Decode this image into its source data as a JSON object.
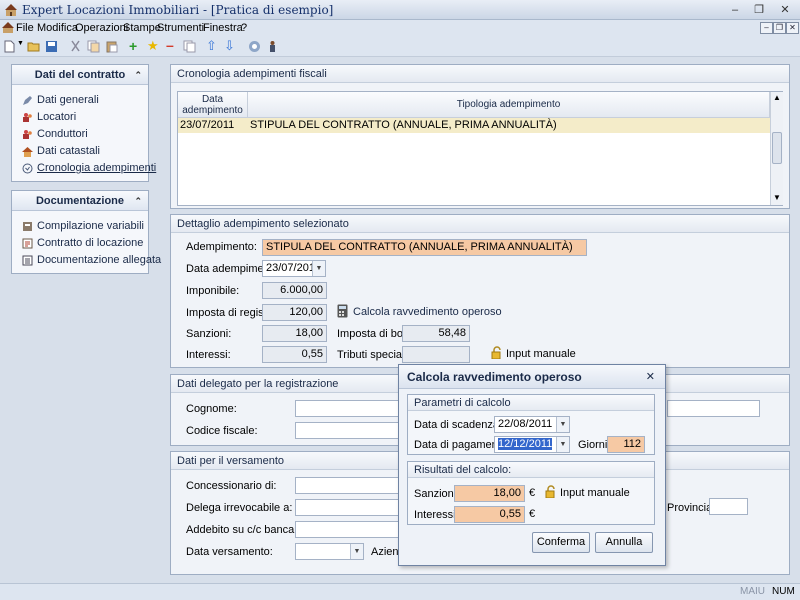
{
  "window": {
    "title": "Expert Locazioni Immobiliari - [Pratica di esempio]",
    "controls": [
      "minimize",
      "restore",
      "close"
    ]
  },
  "menu": [
    "File",
    "Modifica",
    "Operazioni",
    "Stampe",
    "Strumenti",
    "Finestra",
    "?"
  ],
  "sidebar": {
    "contract": {
      "title": "Dati del contratto",
      "items": [
        {
          "label": "Dati generali",
          "icon": "pencil-icon"
        },
        {
          "label": "Locatori",
          "icon": "people-icon"
        },
        {
          "label": "Conduttori",
          "icon": "people-icon"
        },
        {
          "label": "Dati catastali",
          "icon": "house-icon"
        },
        {
          "label": "Cronologia adempimenti",
          "icon": "history-icon"
        }
      ]
    },
    "docs": {
      "title": "Documentazione",
      "items": [
        {
          "label": "Compilazione variabili",
          "icon": "form-icon"
        },
        {
          "label": "Contratto di locazione",
          "icon": "document-icon"
        },
        {
          "label": "Documentazione allegata",
          "icon": "attachment-icon"
        }
      ]
    }
  },
  "history": {
    "title": "Cronologia adempimenti fiscali",
    "col_date": "Data adempimento",
    "col_type": "Tipologia adempimento",
    "rows": [
      {
        "date": "23/07/2011",
        "type": "STIPULA DEL CONTRATTO (ANNUALE, PRIMA ANNUALITÀ)"
      }
    ]
  },
  "detail": {
    "title": "Dettaglio adempimento selezionato",
    "adempimento_label": "Adempimento:",
    "adempimento_value": "STIPULA DEL CONTRATTO (ANNUALE, PRIMA ANNUALITÀ)",
    "data_label": "Data adempimento:",
    "data_value": "23/07/2011",
    "imponibile_label": "Imponibile:",
    "imponibile_value": "6.000,00",
    "imposta_registro_label": "Imposta di registro:",
    "imposta_registro_value": "120,00",
    "calcola_label": "Calcola ravvedimento operoso",
    "sanzioni_label": "Sanzioni:",
    "sanzioni_value": "18,00",
    "imposta_bollo_label": "Imposta di bollo:",
    "imposta_bollo_value": "58,48",
    "interessi_label": "Interessi:",
    "interessi_value": "0,55",
    "tributi_label": "Tributi speciali:",
    "tributi_value": "",
    "input_manuale_label": "Input manuale"
  },
  "delegato": {
    "title": "Dati delegato per la registrazione",
    "cognome_label": "Cognome:",
    "codice_fiscale_label": "Codice fiscale:"
  },
  "versamento": {
    "title": "Dati per il versamento",
    "concessionario_label": "Concessionario di:",
    "delega_label": "Delega irrevocabile a:",
    "addebito_label": "Addebito su c/c bancario n.:",
    "data_versamento_label": "Data versamento:",
    "azienda_label": "Aziend",
    "provincia_label": "Provincia:"
  },
  "dialog": {
    "title": "Calcola ravvedimento operoso",
    "params_title": "Parametri di calcolo",
    "scadenza_label": "Data di scadenza:",
    "scadenza_value": "22/08/2011",
    "pagamento_label": "Data di pagamento:",
    "pagamento_value": "12/12/2011",
    "giorni_label": "Giorni:",
    "giorni_value": "112",
    "results_title": "Risultati del calcolo:",
    "sanzioni_label": "Sanzioni:",
    "sanzioni_value": "18,00",
    "interessi_label": "Interessi:",
    "interessi_value": "0,55",
    "currency": "€",
    "input_manuale_label": "Input manuale",
    "confirm_label": "Conferma",
    "cancel_label": "Annulla"
  },
  "status": {
    "caps": "MAIU",
    "num": "NUM"
  },
  "colors": {
    "highlight": "#f6c9a4",
    "selected_row": "#f4ecc9",
    "title_text": "#15306a"
  }
}
